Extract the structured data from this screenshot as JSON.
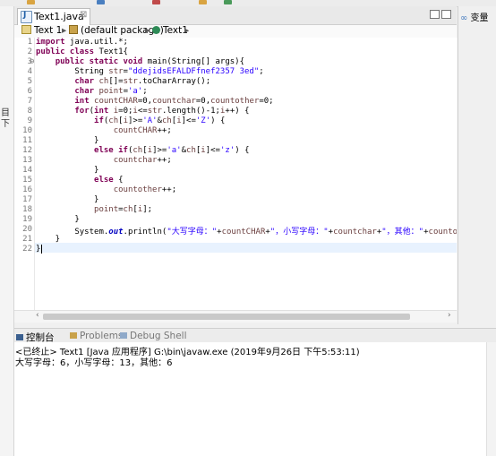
{
  "editor": {
    "tab_label": "Text1.java",
    "close_glyph": "⊠"
  },
  "breadcrumb": {
    "project": "Text 1",
    "package": "(default package)",
    "class": "Text1",
    "separator": "▸"
  },
  "code": {
    "line_numbers": [
      "1",
      "2",
      "3",
      "4",
      "5",
      "6",
      "7",
      "8",
      "9",
      "10",
      "11",
      "12",
      "13",
      "14",
      "15",
      "16",
      "17",
      "18",
      "19",
      "20",
      "21",
      "22"
    ],
    "fold_marker": "⊖"
  },
  "right_panel": {
    "tab_label": "变量"
  },
  "left_strip": {
    "chars": [
      "目",
      "下"
    ]
  },
  "console": {
    "tabs": [
      "控制台",
      "Problems",
      "Debug Shell"
    ],
    "status": "<已终止> Text1 [Java 应用程序] G:\\bin\\javaw.exe  (2019年9月26日 下午5:53:11)",
    "output": "大写字母：6，小写字母：13，其他：6"
  },
  "colors": {
    "keyword": "#7f0055",
    "string": "#2a00ff",
    "field": "#0000c0",
    "current_line": "#e8f2fe"
  }
}
